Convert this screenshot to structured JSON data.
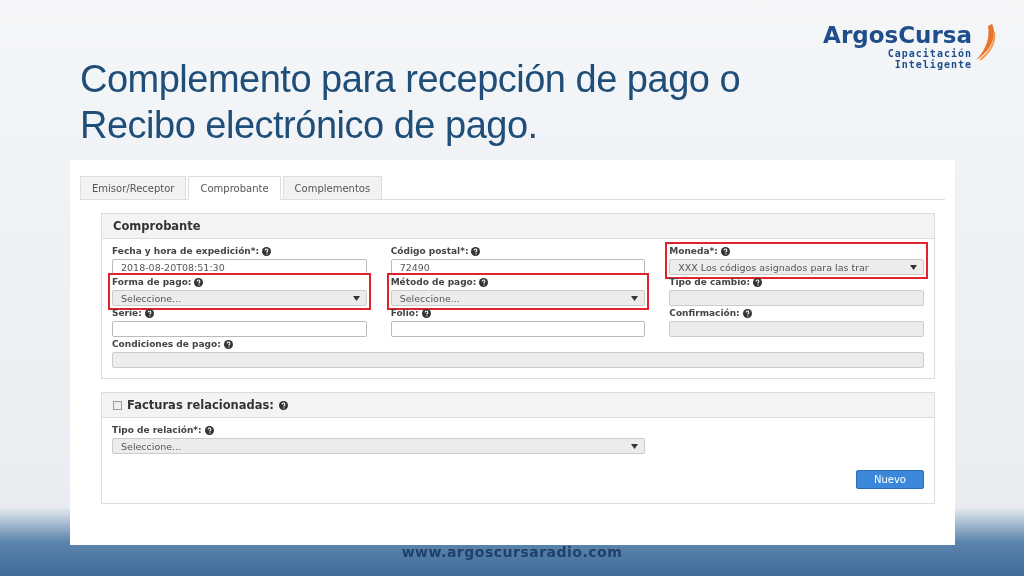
{
  "logo": {
    "name": "ArgosCursa",
    "tagline_1": "Capacitación",
    "tagline_2": "Inteligente"
  },
  "title": "Complemento para recepción de pago o Recibo electrónico de pago.",
  "tabs": [
    {
      "label": "Emisor/Receptor",
      "selected": false
    },
    {
      "label": "Comprobante",
      "selected": true
    },
    {
      "label": "Complementos",
      "selected": false
    }
  ],
  "comprobante": {
    "heading": "Comprobante",
    "fields": [
      {
        "label": "Fecha y hora de expedición*:",
        "kind": "text",
        "value": "2018-08-20T08:51:30",
        "highlighted": false
      },
      {
        "label": "Código postal*:",
        "kind": "text",
        "value": "72490",
        "highlighted": false
      },
      {
        "label": "Moneda*:",
        "kind": "select",
        "value": "XXX Los códigos asignados para las trar",
        "highlighted": true
      },
      {
        "label": "Forma de pago:",
        "kind": "select",
        "value": "Seleccione...",
        "highlighted": true
      },
      {
        "label": "Método de pago:",
        "kind": "select",
        "value": "Seleccione...",
        "highlighted": true
      },
      {
        "label": "Tipo de cambio:",
        "kind": "readonly",
        "highlighted": false
      },
      {
        "label": "Serie:",
        "kind": "text",
        "highlighted": false
      },
      {
        "label": "Folio:",
        "kind": "text",
        "highlighted": false
      },
      {
        "label": "Confirmación:",
        "kind": "readonly",
        "highlighted": false
      },
      {
        "label": "Condiciones de pago:",
        "kind": "readonly",
        "highlighted": false,
        "wide": true
      }
    ]
  },
  "facturas": {
    "heading": "Facturas relacionadas:",
    "checked": false,
    "field": {
      "label": "Tipo de relación*:",
      "kind": "select",
      "value": "Seleccione..."
    },
    "button": "Nuevo"
  },
  "footer": "www.argoscursaradio.com"
}
